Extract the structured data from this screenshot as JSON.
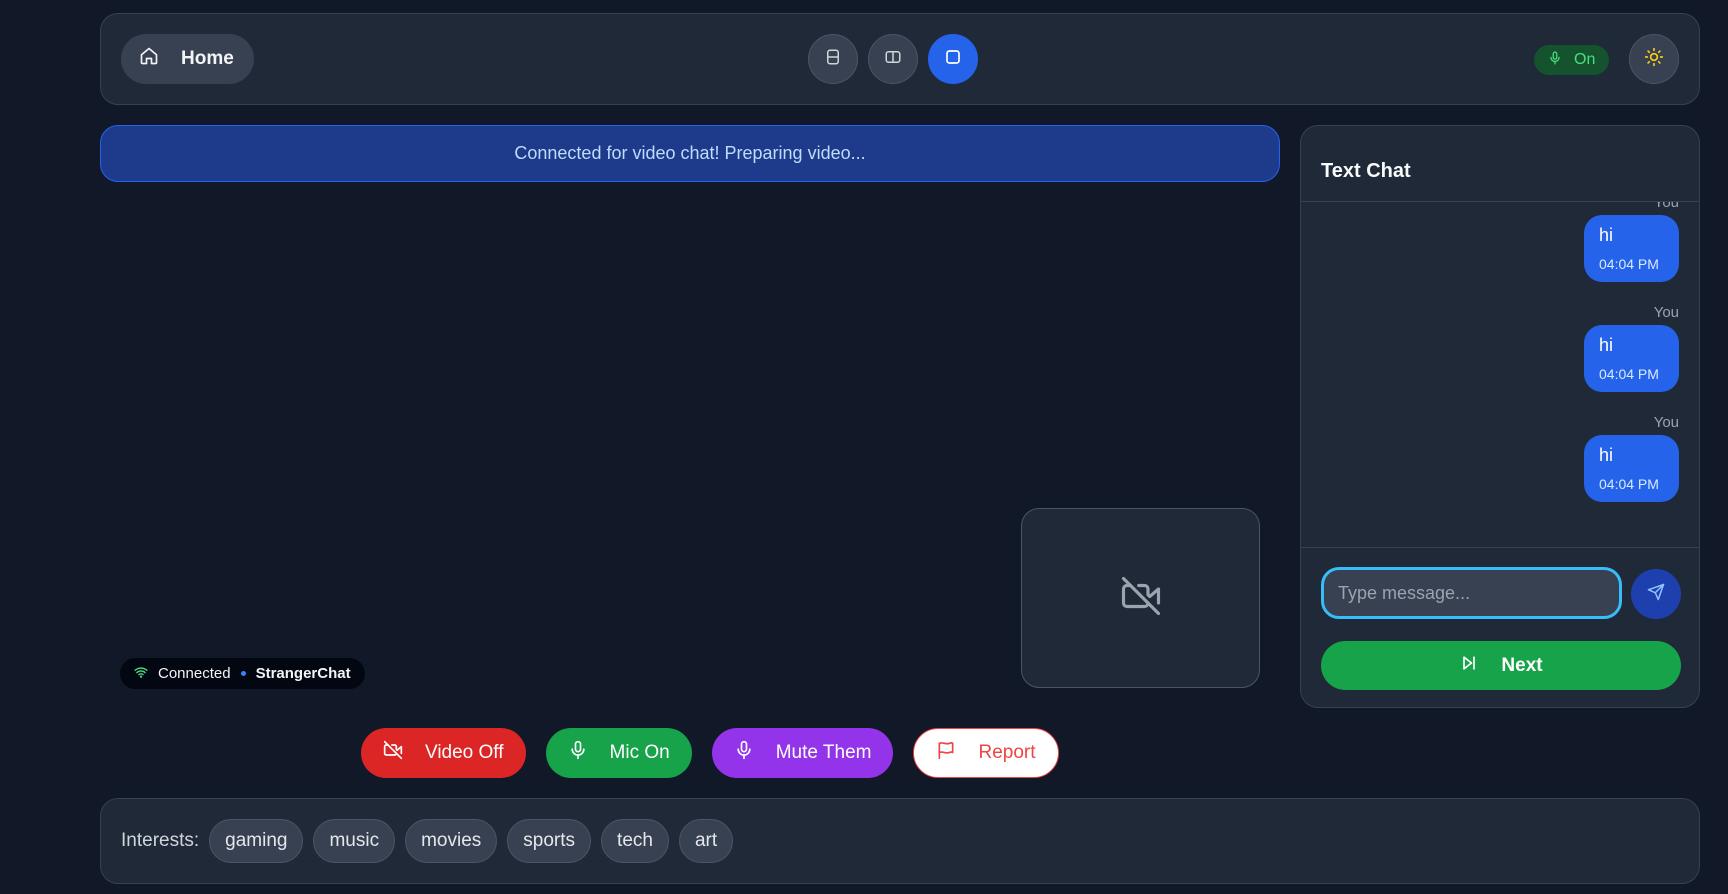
{
  "header": {
    "home_label": "Home",
    "mic_status": "On"
  },
  "status": {
    "banner": "Connected for video chat! Preparing video..."
  },
  "connection": {
    "state": "Connected",
    "brand": "StrangerChat"
  },
  "controls": {
    "video_label": "Video Off",
    "mic_label": "Mic On",
    "mute_label": "Mute Them",
    "report_label": "Report"
  },
  "chat": {
    "title": "Text Chat",
    "messages": [
      {
        "sender": "You",
        "text": "hi",
        "time": "04:04 PM"
      },
      {
        "sender": "You",
        "text": "hi",
        "time": "04:04 PM"
      },
      {
        "sender": "You",
        "text": "hi",
        "time": "04:04 PM"
      }
    ],
    "input_placeholder": "Type message...",
    "next_label": "Next"
  },
  "interests": {
    "label": "Interests:",
    "tags": [
      "gaming",
      "music",
      "movies",
      "sports",
      "tech",
      "art"
    ]
  },
  "colors": {
    "accent": "#2563eb",
    "success": "#16a34a",
    "danger": "#dc2626",
    "purple": "#9333ea",
    "background": "#111827"
  },
  "icons": {
    "home": "home-icon",
    "layout_horizontal": "layout-rows-icon",
    "layout_vertical": "layout-columns-icon",
    "layout_single": "square-icon",
    "mic": "mic-icon",
    "theme": "sun-icon",
    "camera_off": "video-off-icon",
    "wifi": "wifi-icon",
    "flag": "flag-icon",
    "send": "send-icon",
    "skip": "skip-forward-icon"
  }
}
